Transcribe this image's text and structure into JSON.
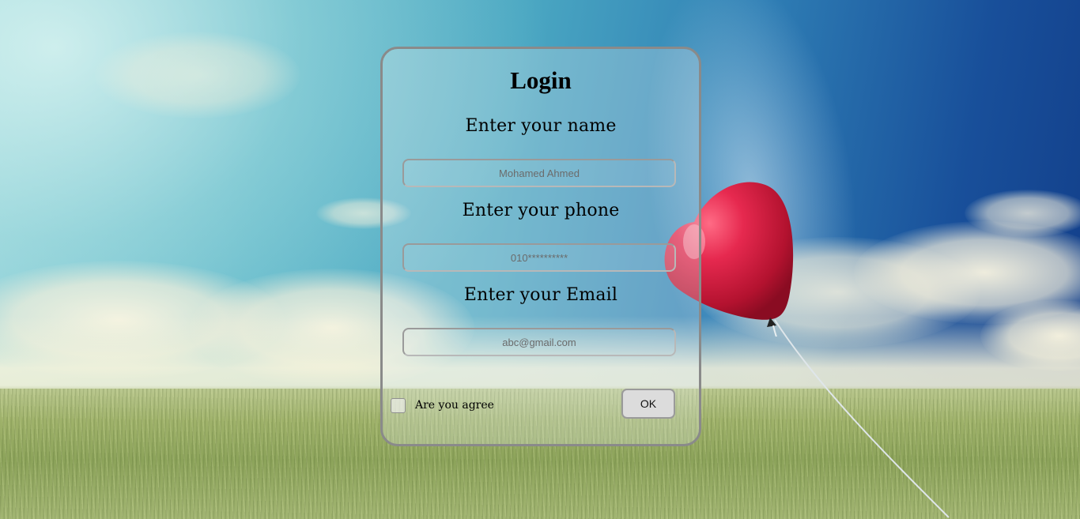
{
  "form": {
    "title": "Login",
    "fields": [
      {
        "label": "Enter your name",
        "placeholder": "Mohamed Ahmed"
      },
      {
        "label": "Enter your phone",
        "placeholder": "010**********"
      },
      {
        "label": "Enter your Email",
        "placeholder": "abc@gmail.com"
      }
    ],
    "agree_label": "Are you agree",
    "agree_checked": false,
    "ok_label": "OK"
  },
  "colors": {
    "balloon": "#d9254a",
    "card_border": "#8a8a8a",
    "button_bg": "#dcdcdc"
  }
}
